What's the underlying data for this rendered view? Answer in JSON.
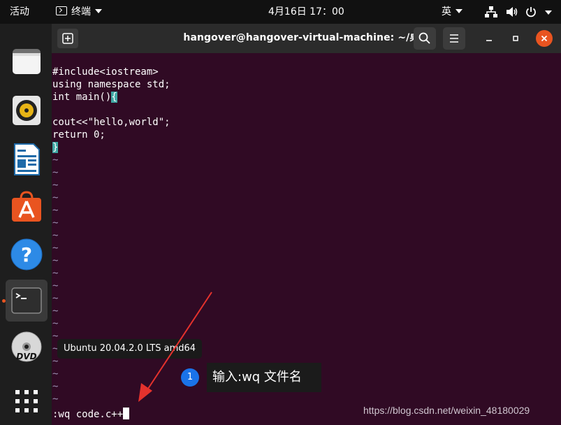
{
  "topbar": {
    "activities": "活动",
    "app_menu": "终端",
    "clock": "4月16日  17：00",
    "input_method": "英"
  },
  "window": {
    "title": "hangover@hangover-virtual-machine: ~/桌面"
  },
  "editor": {
    "lines": [
      "#include<iostream>",
      "using namespace std;",
      "int main()",
      "",
      "cout<<\"hello,world\";",
      "return 0;"
    ],
    "open_brace": "{",
    "close_brace": "}",
    "tilde": "~",
    "command": ":wq code.c++"
  },
  "dock": {
    "tooltip": "Ubuntu 20.04.2.0 LTS amd64",
    "items": [
      "files-icon",
      "rhythmbox-icon",
      "writer-icon",
      "software-icon",
      "help-icon",
      "terminal-icon",
      "dvd-icon",
      "show-apps-icon"
    ]
  },
  "annotation": {
    "number": "1",
    "text": "输入:wq 文件名"
  },
  "watermark": "https://blog.csdn.net/weixin_48180029",
  "colors": {
    "terminal_bg": "#300a24",
    "accent": "#e95420",
    "bracket_match": "#3fa7a3",
    "annotation_badge": "#1a73e8"
  }
}
